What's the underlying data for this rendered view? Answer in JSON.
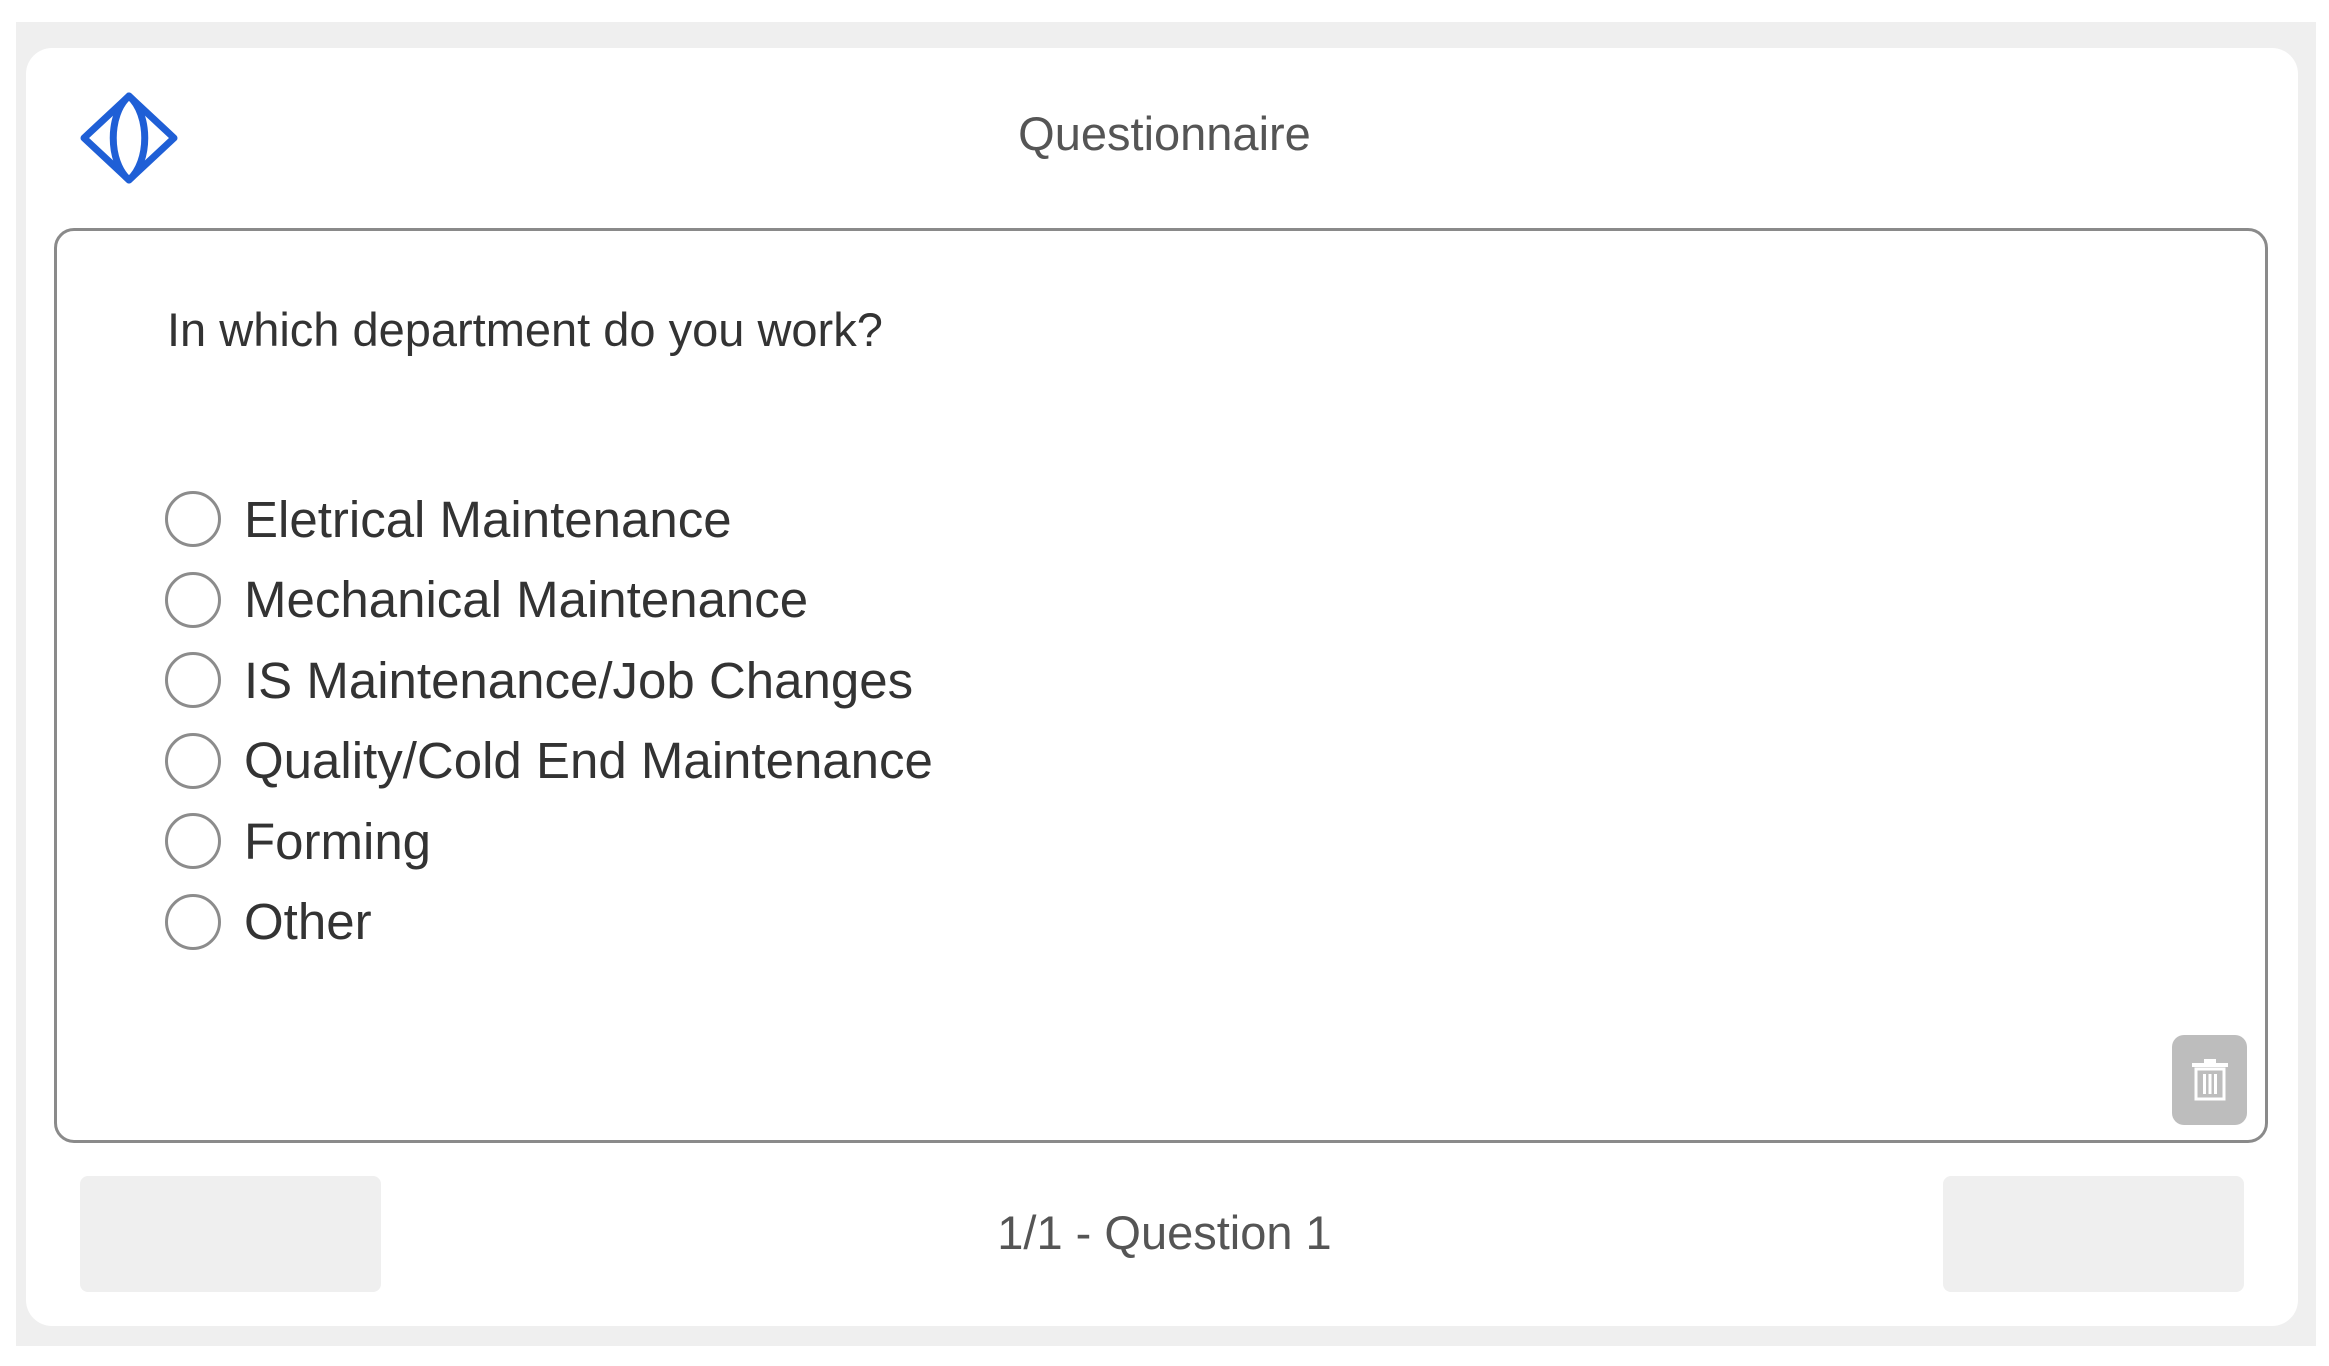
{
  "header": {
    "title": "Questionnaire",
    "logo_icon": "diamond-logo-icon",
    "brand_color": "#1f5fd6"
  },
  "question": {
    "text": "In which department do you work?",
    "options": [
      {
        "label": "Eletrical Maintenance",
        "selected": false
      },
      {
        "label": "Mechanical Maintenance",
        "selected": false
      },
      {
        "label": "IS Maintenance/Job Changes",
        "selected": false
      },
      {
        "label": "Quality/Cold End Maintenance",
        "selected": false
      },
      {
        "label": "Forming",
        "selected": false
      },
      {
        "label": "Other",
        "selected": false
      }
    ],
    "trash_icon": "trash-icon"
  },
  "footer": {
    "progress_text": "1/1 - Question 1",
    "prev_label": "",
    "next_label": ""
  }
}
